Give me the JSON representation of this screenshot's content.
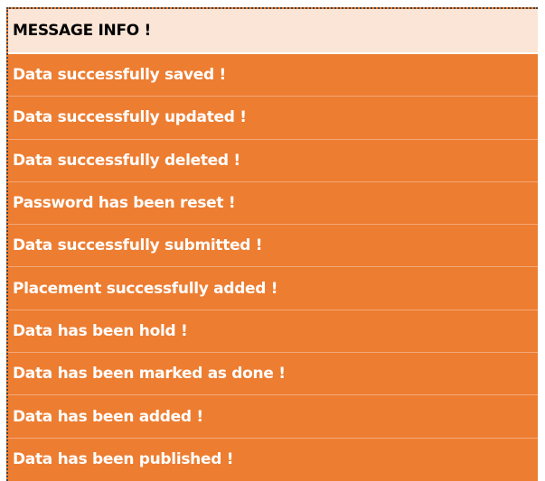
{
  "table": {
    "header": "MESSAGE INFO !",
    "messages": [
      "Data successfully saved !",
      "Data successfully updated !",
      "Data successfully deleted !",
      "Password has been reset !",
      "Data successfully submitted !",
      "Placement successfully added !",
      "Data has been hold !",
      "Data has been marked as done !",
      "Data has been added !",
      "Data has been published !"
    ]
  },
  "colors": {
    "header_background": "#fbe5d6",
    "row_background": "#ed7d31",
    "row_text": "#ffffff",
    "header_text": "#000000"
  }
}
